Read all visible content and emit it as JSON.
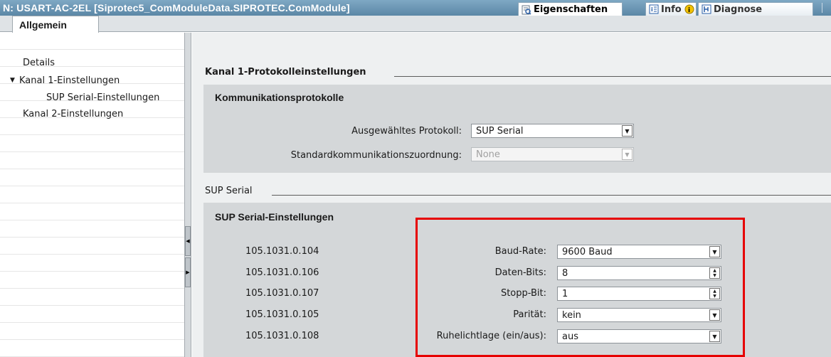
{
  "window": {
    "title": "N: USART-AC-2EL [Siprotec5_ComModuleData.SIPROTEC.ComModule]"
  },
  "top_tabs": {
    "properties": "Eigenschaften",
    "info": "Info",
    "diagnostics": "Diagnose"
  },
  "sub_tabs": {
    "general": "Allgemein"
  },
  "sidebar": {
    "items": [
      {
        "label": "Details"
      },
      {
        "label": "Kanal 1-Einstellungen",
        "expanded": true
      },
      {
        "label": "SUP Serial-Einstellungen"
      },
      {
        "label": "Kanal 2-Einstellungen"
      }
    ]
  },
  "channel1": {
    "section_title": "Kanal 1-Protokolleinstellungen",
    "protocols": {
      "title": "Kommunikationsprotokolle",
      "selected_protocol_label": "Ausgewähltes Protokoll:",
      "selected_protocol_value": "SUP Serial",
      "std_mapping_label": "Standardkommunikationszuordnung:",
      "std_mapping_value": "None"
    }
  },
  "sup_serial": {
    "section_title": "SUP Serial",
    "title": "SUP Serial-Einstellungen",
    "params": [
      {
        "address": "105.1031.0.104",
        "label": "Baud-Rate:",
        "value": "9600 Baud",
        "control": "dropdown"
      },
      {
        "address": "105.1031.0.106",
        "label": "Daten-Bits:",
        "value": "8",
        "control": "spinner"
      },
      {
        "address": "105.1031.0.107",
        "label": "Stopp-Bit:",
        "value": "1",
        "control": "spinner"
      },
      {
        "address": "105.1031.0.105",
        "label": "Parität:",
        "value": "kein",
        "control": "dropdown"
      },
      {
        "address": "105.1031.0.108",
        "label": "Ruhelichtlage (ein/aus):",
        "value": "aus",
        "control": "dropdown"
      }
    ]
  },
  "colors": {
    "highlight_box": "#e60000",
    "title_bar": "#6a93b1",
    "group_bg": "#d4d7d9"
  }
}
